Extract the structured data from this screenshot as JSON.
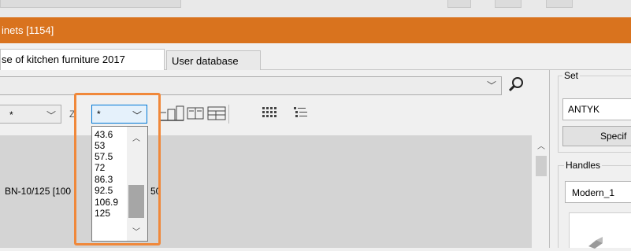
{
  "window": {
    "title": "inets [1154]"
  },
  "tabs": [
    {
      "label": "se of kitchen furniture 2017",
      "active": true
    },
    {
      "label": "User database",
      "active": false
    }
  ],
  "toolbar": {
    "main_combo_value": "",
    "filter1_value": "*",
    "filter2_label": "Z",
    "filter2_value": "*"
  },
  "dropdown": {
    "options": [
      "43.6",
      "53",
      "57.5",
      "72",
      "86.3",
      "92.5",
      "106.9",
      "125"
    ]
  },
  "grid": {
    "row_text": "BN-10/125  [100",
    "row_trail": "50"
  },
  "right_panel": {
    "set_label": "Set",
    "set_value": "ANTYK",
    "spec_button": "Specif",
    "handles_label": "Handles",
    "handles_value": "Modern_1"
  },
  "colors": {
    "titlebar": "#d9731e",
    "highlight": "#f0883a",
    "focus": "#0078d7"
  }
}
